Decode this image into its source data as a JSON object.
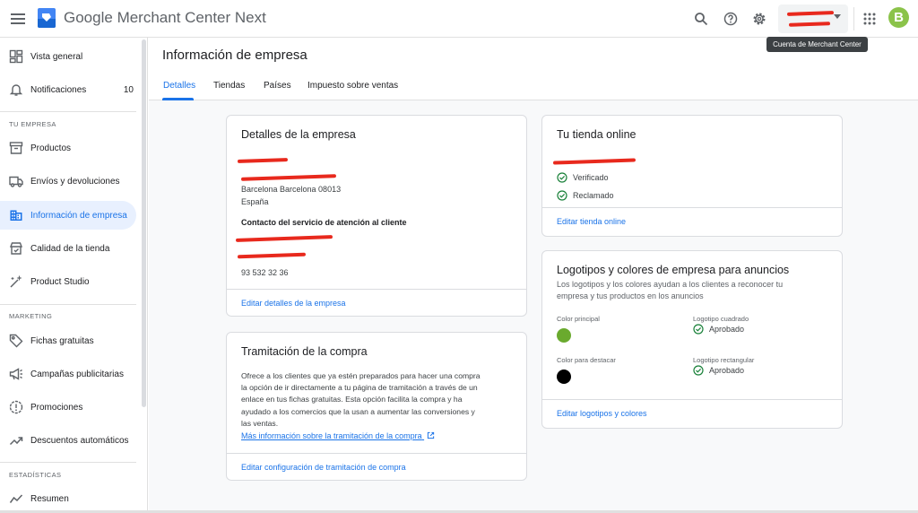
{
  "header": {
    "title_brand": "Google",
    "title_product": "Merchant Center Next",
    "account_line1": "",
    "account_line2": "",
    "tooltip": "Cuenta de Merchant Center",
    "avatar_letter": "B"
  },
  "sidebar": {
    "items_top": [
      {
        "label": "Vista general",
        "icon": "dashboard-icon"
      },
      {
        "label": "Notificaciones",
        "icon": "bell-icon",
        "count": "10"
      }
    ],
    "section_tu_empresa": "TU EMPRESA",
    "items_empresa": [
      {
        "label": "Productos",
        "icon": "products-icon"
      },
      {
        "label": "Envíos y devoluciones",
        "icon": "truck-icon"
      },
      {
        "label": "Información de empresa",
        "icon": "business-icon",
        "active": true
      },
      {
        "label": "Calidad de la tienda",
        "icon": "store-quality-icon"
      },
      {
        "label": "Product Studio",
        "icon": "magic-wand-icon"
      }
    ],
    "section_marketing": "MARKETING",
    "items_marketing": [
      {
        "label": "Fichas gratuitas",
        "icon": "tag-icon"
      },
      {
        "label": "Campañas publicitarias",
        "icon": "megaphone-icon"
      },
      {
        "label": "Promociones",
        "icon": "promo-icon"
      },
      {
        "label": "Descuentos automáticos",
        "icon": "trend-icon"
      }
    ],
    "section_estadisticas": "ESTADÍSTICAS",
    "items_estadisticas": [
      {
        "label": "Resumen",
        "icon": "chart-line-icon"
      }
    ]
  },
  "page": {
    "title": "Información de empresa",
    "tabs": [
      "Detalles",
      "Tiendas",
      "Países",
      "Impuesto sobre ventas"
    ]
  },
  "detalles": {
    "title": "Detalles de la empresa",
    "address_city": "Barcelona Barcelona 08013",
    "address_country": "España",
    "contact_heading": "Contacto del servicio de atención al cliente",
    "phone": "93 532 32 36",
    "edit_link": "Editar detalles de la empresa"
  },
  "tramitacion": {
    "title": "Tramitación de la compra",
    "lines": [
      "Ofrece a los clientes que ya estén preparados para hacer una compra",
      "la opción de ir directamente a tu página de tramitación a través de un",
      "enlace en tus fichas gratuitas. Esta opción facilita la compra y ha",
      "ayudado a los comercios que la usan a aumentar las conversiones y",
      "las ventas."
    ],
    "more_link": "Más información sobre la tramitación de la compra",
    "edit_link": "Editar configuración de tramitación de compra"
  },
  "tienda": {
    "title": "Tu tienda online",
    "status1": "Verificado",
    "status2": "Reclamado",
    "edit_link": "Editar tienda online"
  },
  "logos": {
    "title": "Logotipos y colores de empresa para anuncios",
    "desc_line1": "Los logotipos y los colores ayudan a los clientes a reconocer tu",
    "desc_line2": "empresa y tus productos en los anuncios",
    "color_principal_label": "Color principal",
    "color_principal": "#6aaa2e",
    "color_destacar_label": "Color para destacar",
    "color_destacar": "#000000",
    "logo_cuadrado_label": "Logotipo cuadrado",
    "logo_cuadrado_status": "Aprobado",
    "logo_rect_label": "Logotipo rectangular",
    "logo_rect_status": "Aprobado",
    "edit_link": "Editar logotipos y colores"
  },
  "colors": {
    "accent": "#1a73e8",
    "success": "#188038",
    "redaction": "#e8291d"
  }
}
